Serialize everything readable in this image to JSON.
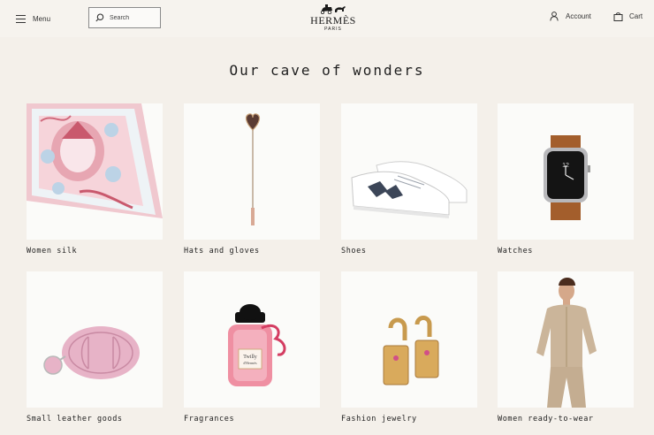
{
  "header": {
    "menu_label": "Menu",
    "search_placeholder": "Search",
    "logo_word": "HERMÈS",
    "logo_city": "PARIS",
    "account_label": "Account",
    "cart_label": "Cart"
  },
  "section": {
    "title": "Our cave of wonders"
  },
  "categories": [
    {
      "label": "Women silk"
    },
    {
      "label": "Hats and gloves"
    },
    {
      "label": "Shoes"
    },
    {
      "label": "Watches"
    },
    {
      "label": "Small leather goods"
    },
    {
      "label": "Fragrances"
    },
    {
      "label": "Fashion jewelry"
    },
    {
      "label": "Women ready-to-wear"
    }
  ],
  "colors": {
    "background": "#f4f0ea",
    "tile_background": "#fbfbf9",
    "text": "#2b2b2b"
  }
}
